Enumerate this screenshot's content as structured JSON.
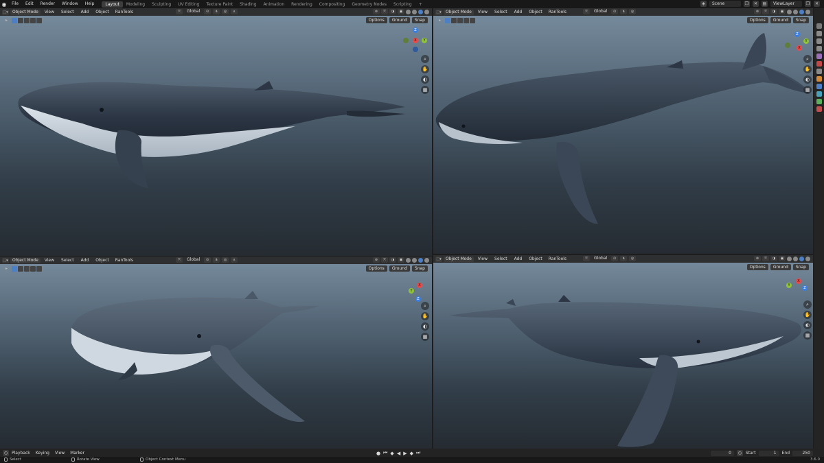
{
  "topbar": {
    "menus": [
      "File",
      "Edit",
      "Render",
      "Window",
      "Help"
    ],
    "workspaces": [
      "Layout",
      "Modeling",
      "Sculpting",
      "UV Editing",
      "Texture Paint",
      "Shading",
      "Animation",
      "Rendering",
      "Compositing",
      "Geometry Nodes",
      "Scripting",
      "+"
    ],
    "active_workspace": "Layout",
    "scene": "Scene",
    "view_layer": "ViewLayer"
  },
  "viewport_header": {
    "mode": "Object Mode",
    "menus": [
      "View",
      "Select",
      "Add",
      "Object",
      "RanTools"
    ],
    "transform_orientation": "Global",
    "options": "Options",
    "ground": "Ground",
    "snap": "Snap"
  },
  "gizmo_labels": {
    "z": "Z",
    "y": "Y",
    "x": "X"
  },
  "timeline": {
    "menus": [
      "Playback",
      "Keying",
      "View",
      "Marker"
    ],
    "current_frame": "0",
    "start_label": "Start",
    "start": "1",
    "end_label": "End",
    "end": "250"
  },
  "status": {
    "select": "Select",
    "rotate": "Rotate View",
    "context": "Object Context Menu",
    "version": "3.6.0"
  },
  "colors": {
    "accent": "#4d7fc4",
    "axis_x": "#e84a4a",
    "axis_y": "#8fc23a",
    "axis_z": "#3c7fe0"
  }
}
